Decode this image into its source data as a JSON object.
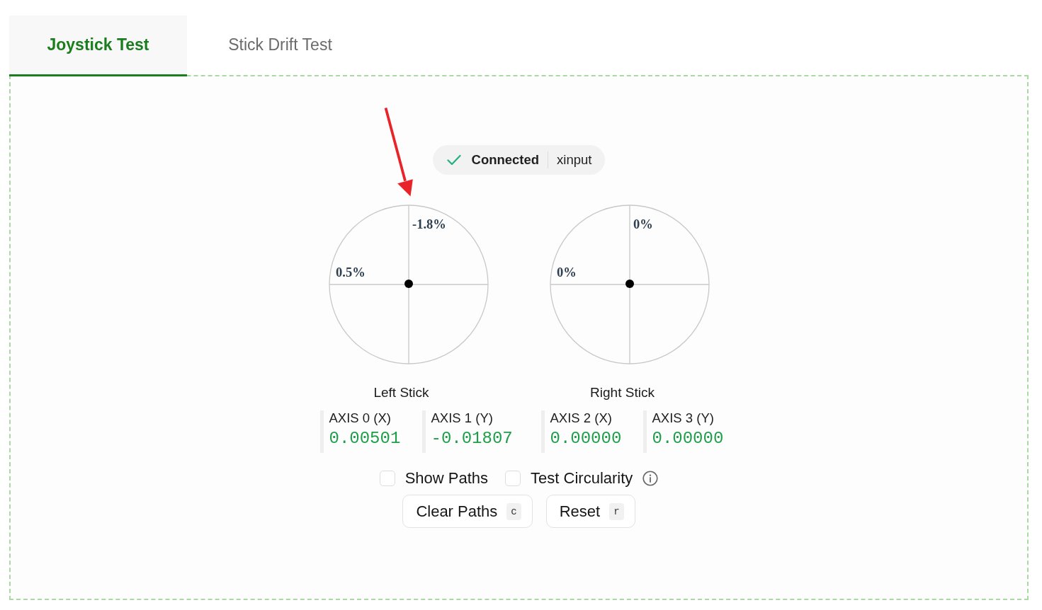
{
  "tabs": [
    {
      "label": "Joystick Test",
      "selected": true
    },
    {
      "label": "Stick Drift Test",
      "selected": false
    }
  ],
  "status": {
    "connected": true,
    "label": "Connected",
    "api": "xinput"
  },
  "sticks": [
    {
      "name": "Left Stick",
      "top_reading": "-1.8%",
      "left_reading": "0.5%",
      "axes": [
        {
          "label": "AXIS 0 (X)",
          "value": "0.00501"
        },
        {
          "label": "AXIS 1 (Y)",
          "value": "-0.01807"
        }
      ]
    },
    {
      "name": "Right Stick",
      "top_reading": "0%",
      "left_reading": "0%",
      "axes": [
        {
          "label": "AXIS 2 (X)",
          "value": "0.00000"
        },
        {
          "label": "AXIS 3 (Y)",
          "value": "0.00000"
        }
      ]
    }
  ],
  "options": [
    {
      "label": "Show Paths",
      "checked": false,
      "info": false
    },
    {
      "label": "Test Circularity",
      "checked": false,
      "info": true
    }
  ],
  "buttons": [
    {
      "label": "Clear Paths",
      "shortcut": "c"
    },
    {
      "label": "Reset",
      "shortcut": "r"
    }
  ]
}
